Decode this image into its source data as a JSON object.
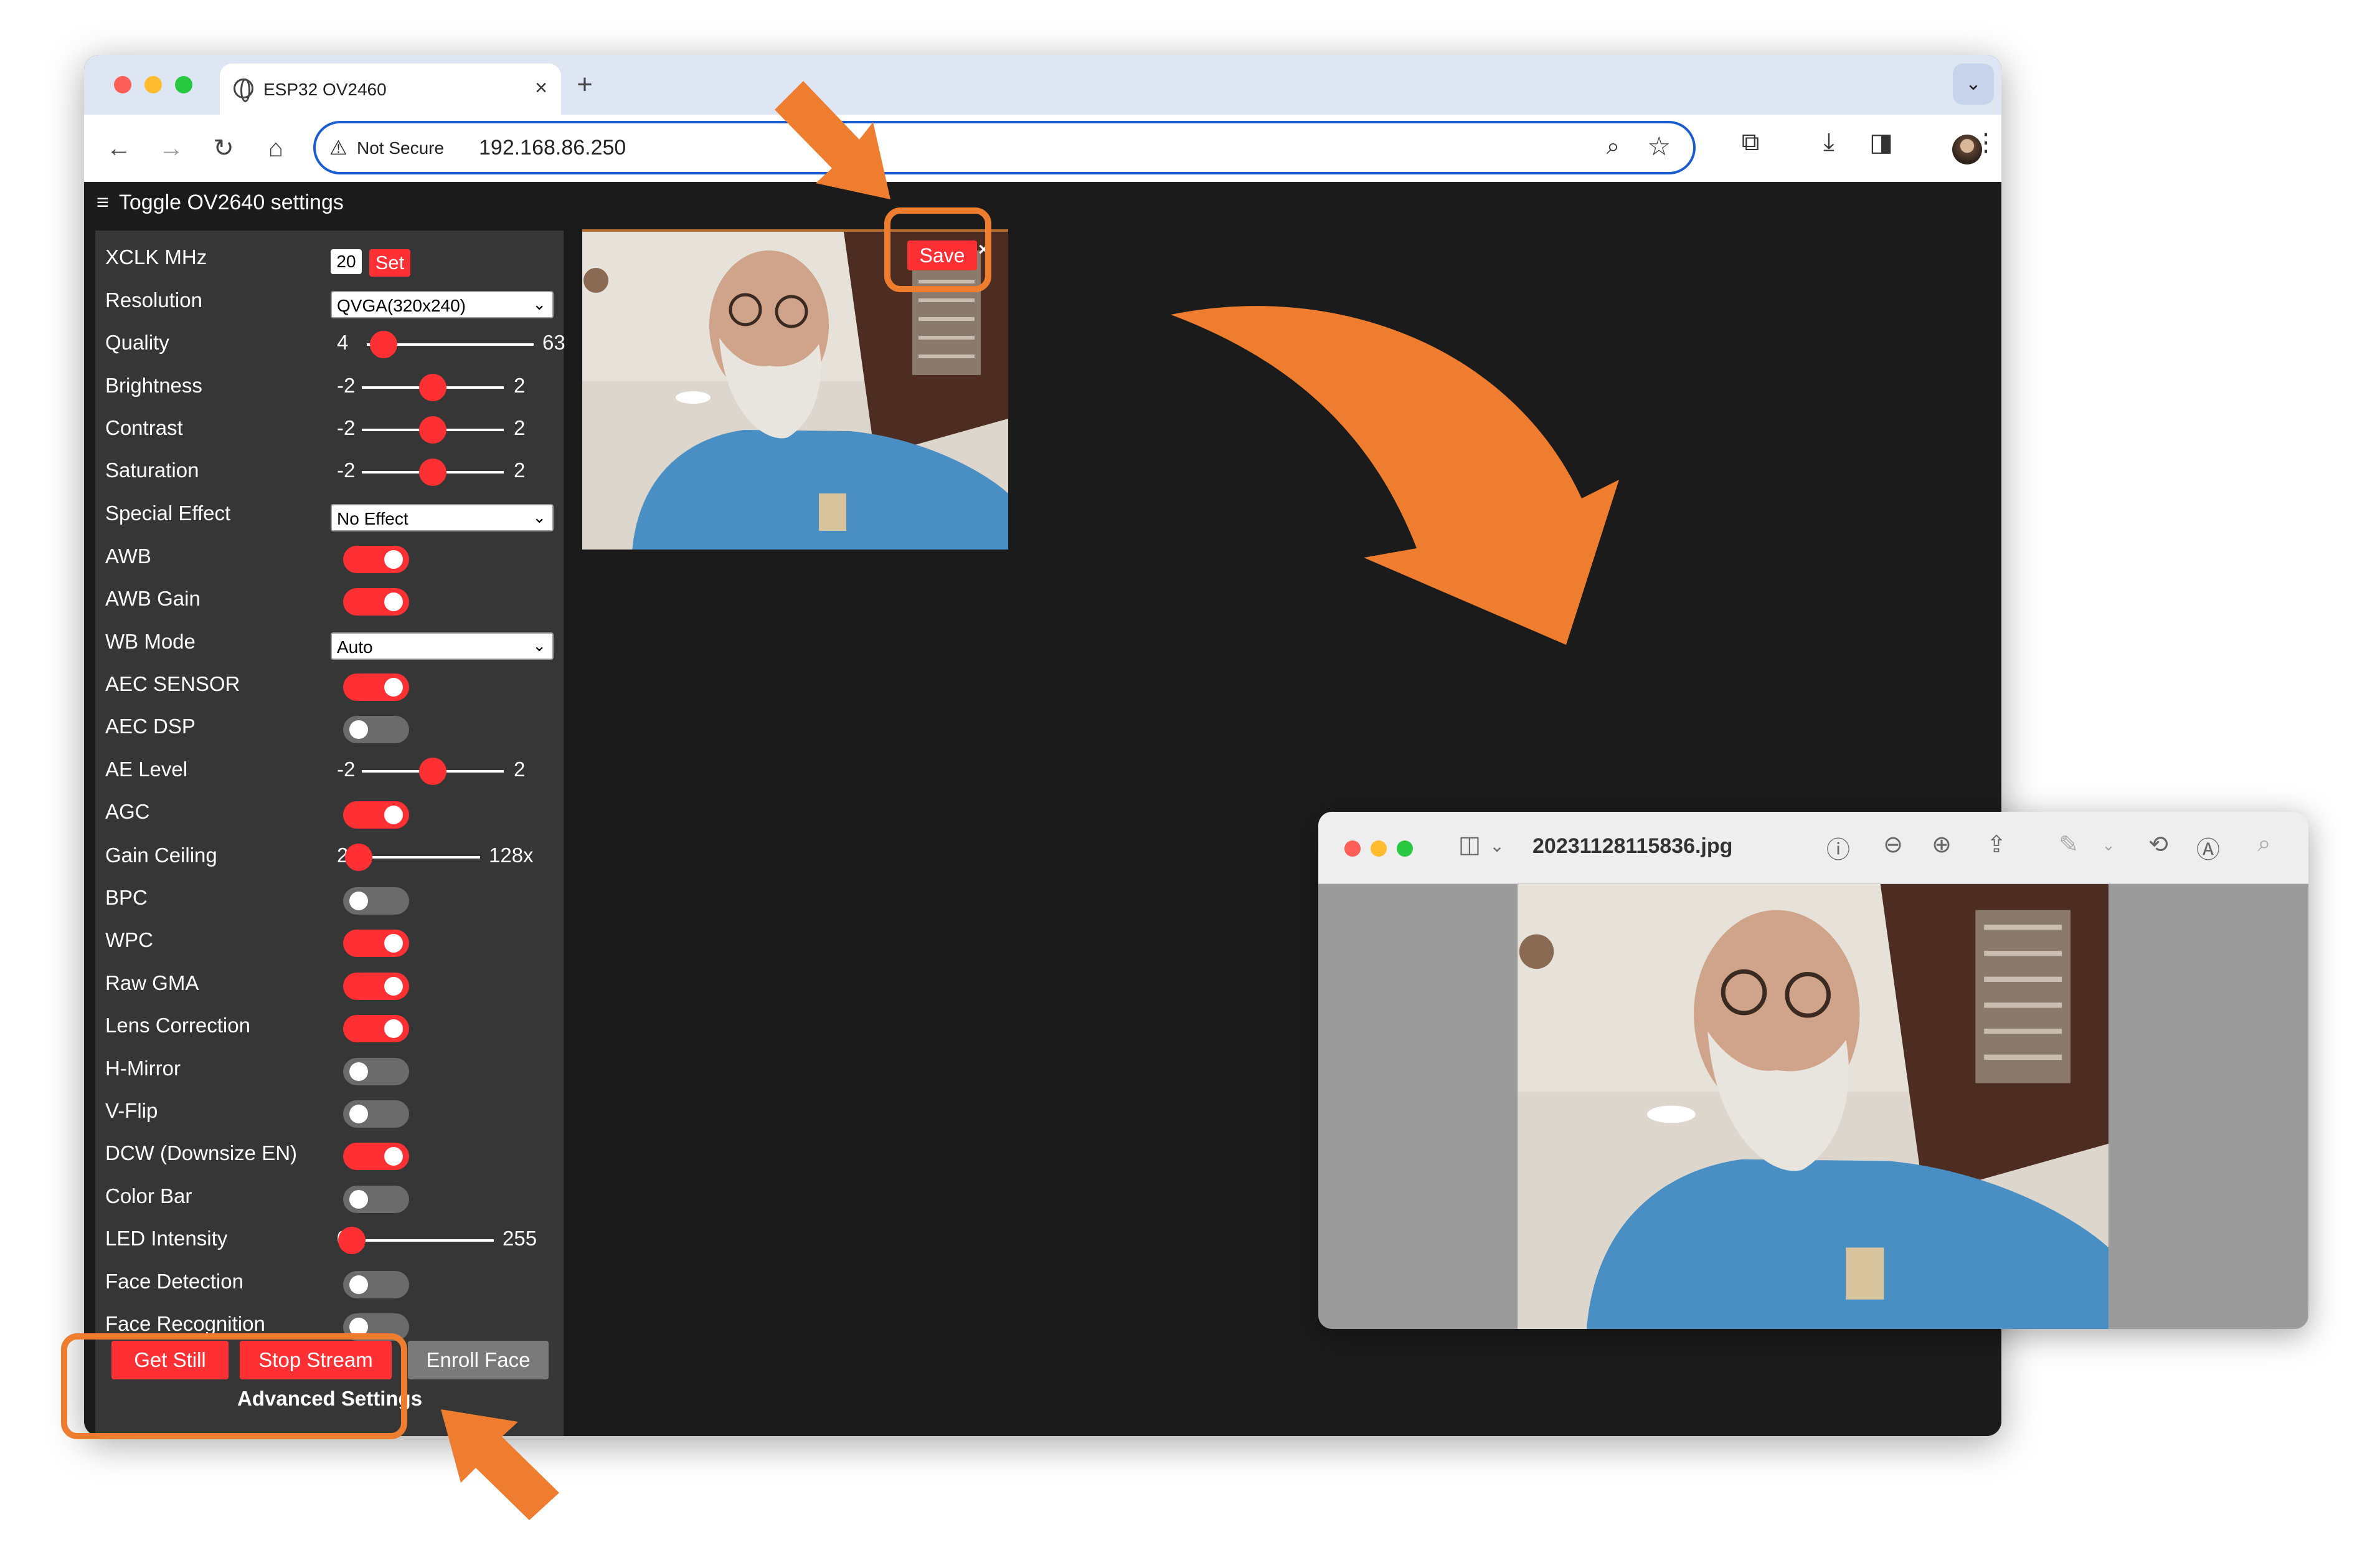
{
  "browser": {
    "tab_title": "ESP32 OV2460",
    "address": {
      "security_label": "Not Secure",
      "url": "192.168.86.250"
    }
  },
  "page": {
    "toggle_label": "Toggle OV2640 settings",
    "controls": [
      {
        "label": "XCLK MHz",
        "kind": "number",
        "value": "20",
        "button": "Set"
      },
      {
        "label": "Resolution",
        "kind": "select",
        "value": "QVGA(320x240)"
      },
      {
        "label": "Quality",
        "kind": "range",
        "min": "4",
        "max": "63",
        "value": 10
      },
      {
        "label": "Brightness",
        "kind": "range",
        "min": "-2",
        "max": "2",
        "value": 0
      },
      {
        "label": "Contrast",
        "kind": "range",
        "min": "-2",
        "max": "2",
        "value": 0
      },
      {
        "label": "Saturation",
        "kind": "range",
        "min": "-2",
        "max": "2",
        "value": 0
      },
      {
        "label": "Special Effect",
        "kind": "select",
        "value": "No Effect"
      },
      {
        "label": "AWB",
        "kind": "toggle",
        "on": true
      },
      {
        "label": "AWB Gain",
        "kind": "toggle",
        "on": true
      },
      {
        "label": "WB Mode",
        "kind": "select",
        "value": "Auto"
      },
      {
        "label": "AEC SENSOR",
        "kind": "toggle",
        "on": true
      },
      {
        "label": "AEC DSP",
        "kind": "toggle",
        "on": false
      },
      {
        "label": "AE Level",
        "kind": "range",
        "min": "-2",
        "max": "2",
        "value": 0
      },
      {
        "label": "AGC",
        "kind": "toggle",
        "on": true
      },
      {
        "label": "Gain Ceiling",
        "kind": "range",
        "min": "2x",
        "max": "128x",
        "value": 0
      },
      {
        "label": "BPC",
        "kind": "toggle",
        "on": false
      },
      {
        "label": "WPC",
        "kind": "toggle",
        "on": true
      },
      {
        "label": "Raw GMA",
        "kind": "toggle",
        "on": true
      },
      {
        "label": "Lens Correction",
        "kind": "toggle",
        "on": true
      },
      {
        "label": "H-Mirror",
        "kind": "toggle",
        "on": false
      },
      {
        "label": "V-Flip",
        "kind": "toggle",
        "on": false
      },
      {
        "label": "DCW (Downsize EN)",
        "kind": "toggle",
        "on": true
      },
      {
        "label": "Color Bar",
        "kind": "toggle",
        "on": false
      },
      {
        "label": "LED Intensity",
        "kind": "range",
        "min": "0",
        "max": "255",
        "value": 0
      },
      {
        "label": "Face Detection",
        "kind": "toggle",
        "on": false
      },
      {
        "label": "Face Recognition",
        "kind": "toggle",
        "on": false
      }
    ],
    "buttons": {
      "get_still": "Get Still",
      "stop_stream": "Stop Stream",
      "enroll_face": "Enroll Face"
    },
    "advanced_label": "Advanced Settings",
    "stream": {
      "save_label": "Save",
      "close_glyph": "×"
    }
  },
  "preview": {
    "filename": "20231128115836.jpg"
  },
  "colors": {
    "accent": "#ff3034",
    "annotation": "#ef7d2f",
    "omnibox_border": "#1a5dd0"
  },
  "icons": [
    "globe-icon",
    "back-icon",
    "forward-icon",
    "reload-icon",
    "home-icon",
    "warning-icon",
    "zoom-icon",
    "star-icon",
    "extensions-icon",
    "download-icon",
    "sidepanel-icon",
    "menu-icon",
    "sidebar-toggle-icon",
    "info-icon",
    "zoom-out-icon",
    "zoom-in-icon",
    "share-icon",
    "markup-icon",
    "rotate-icon",
    "annotate-icon",
    "search-icon"
  ]
}
